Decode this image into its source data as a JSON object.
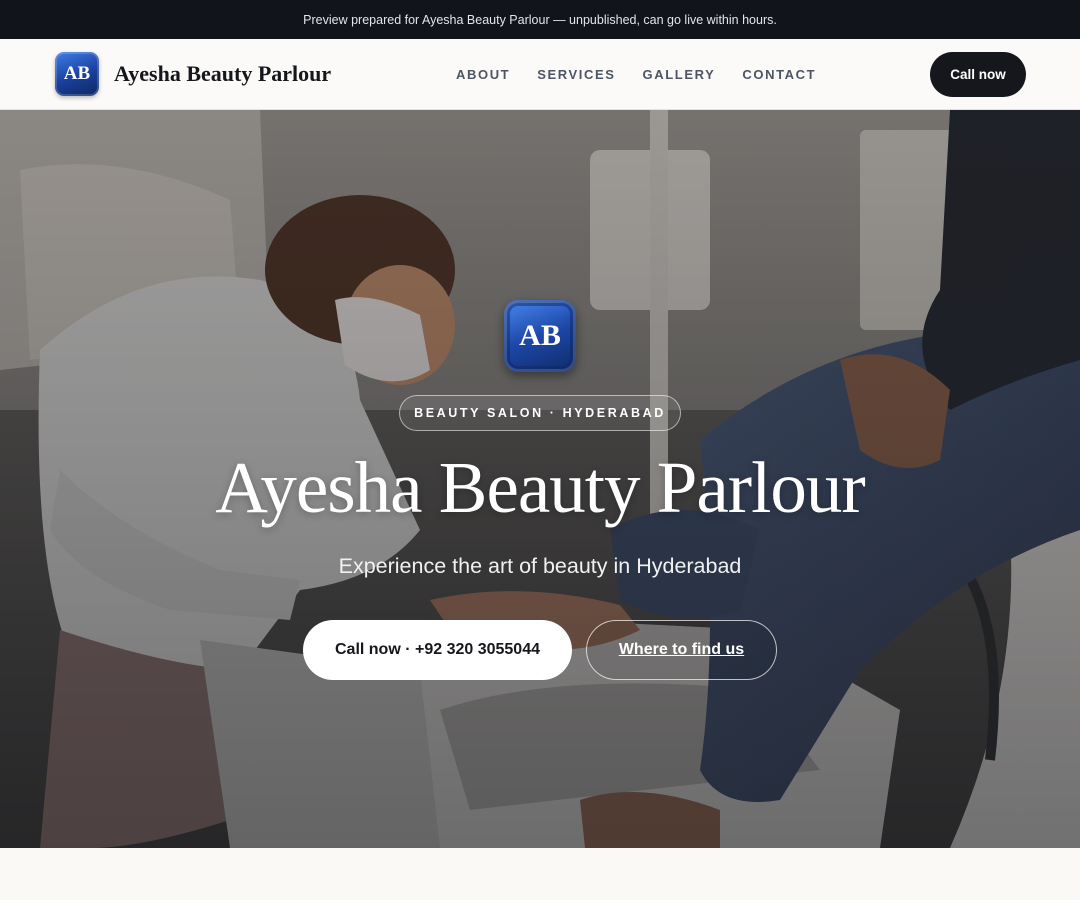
{
  "preview_banner": {
    "text": "Preview prepared for Ayesha Beauty Parlour — unpublished, can go live within hours."
  },
  "header": {
    "logo_initials": "AB",
    "brand_name": "Ayesha Beauty Parlour",
    "nav": [
      {
        "label": "ABOUT"
      },
      {
        "label": "SERVICES"
      },
      {
        "label": "GALLERY"
      },
      {
        "label": "CONTACT"
      }
    ],
    "cta_label": "Call now"
  },
  "hero": {
    "badge_initials": "AB",
    "eyebrow": "BEAUTY SALON · HYDERABAD",
    "title": "Ayesha Beauty Parlour",
    "subtitle": "Experience the art of beauty in Hyderabad",
    "primary_button": "Call now · +92 320 3055044",
    "secondary_button": "Where to find us",
    "background_image": "photo of a beautician in a face mask giving a pedicure to a seated client",
    "brand_color": "#1d47a8"
  }
}
